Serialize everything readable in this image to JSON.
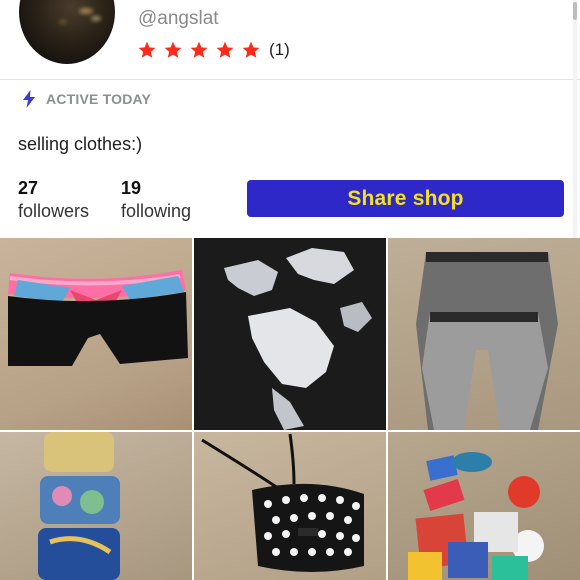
{
  "profile": {
    "username": "@angslat",
    "rating_stars": 5,
    "rating_count": "(1)",
    "status_icon": "lightning-icon",
    "status": "ACTIVE TODAY",
    "bio": "selling clothes:)"
  },
  "stats": {
    "followers_count": "27",
    "followers_label": "followers",
    "following_count": "19",
    "following_label": "following"
  },
  "actions": {
    "share_label": "Share shop"
  },
  "colors": {
    "star": "#ff2a1a",
    "button_bg": "#2f28c8",
    "button_text": "#f6e11b",
    "status_icon": "#3a3fd0"
  },
  "listings": [
    {
      "name": "listing-black-shorts-pink-waistband"
    },
    {
      "name": "listing-world-map-leggings"
    },
    {
      "name": "listing-gray-herringbone-leggings"
    },
    {
      "name": "listing-phone-cases"
    },
    {
      "name": "listing-polka-dot-camera-bag"
    },
    {
      "name": "listing-sticker-pack"
    }
  ]
}
